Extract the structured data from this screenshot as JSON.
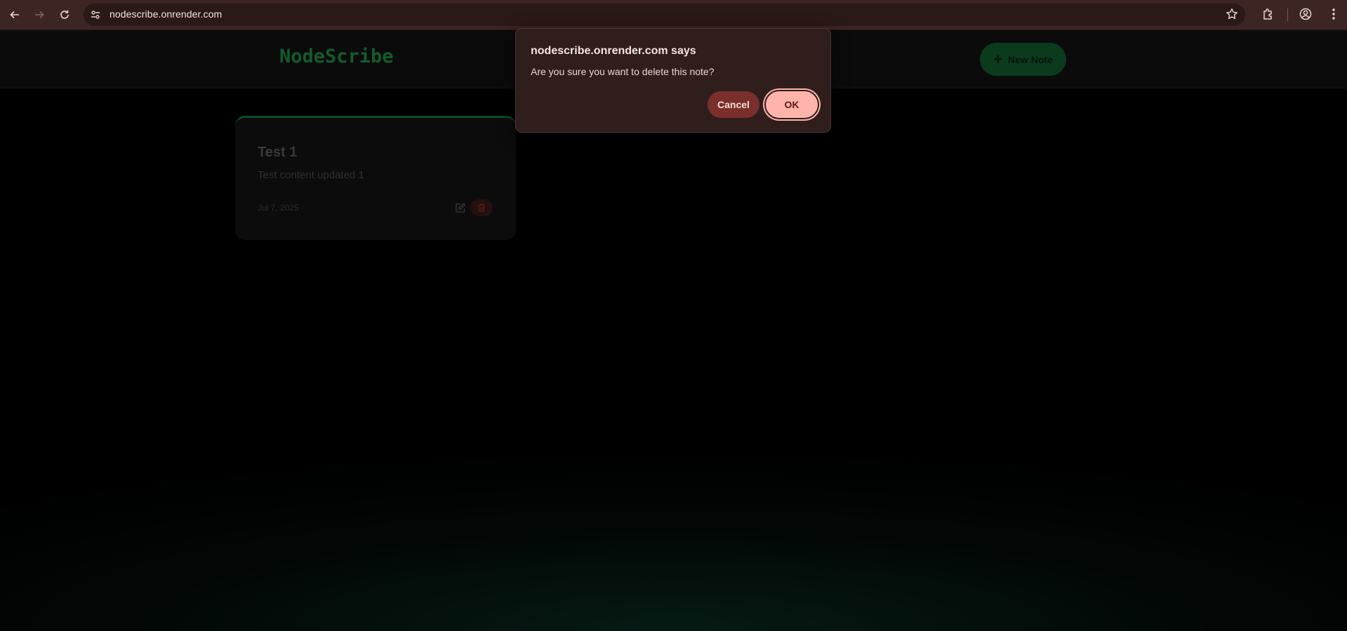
{
  "browser": {
    "url": "nodescribe.onrender.com",
    "icons": [
      "back-icon",
      "forward-icon",
      "reload-icon",
      "site-info-icon",
      "star-icon",
      "extensions-icon",
      "profile-icon",
      "menu-icon"
    ]
  },
  "app": {
    "logo": "NodeScribe",
    "new_note_label": "New Note",
    "new_note_icon": "+",
    "accent": "#0b4d2a"
  },
  "notes": [
    {
      "title": "Test 1",
      "content": "Test content updated 1",
      "date": "Jul 7, 2025"
    }
  ],
  "dialog": {
    "title": "nodescribe.onrender.com says",
    "message": "Are you sure you want to delete this note?",
    "cancel_label": "Cancel",
    "ok_label": "OK"
  }
}
